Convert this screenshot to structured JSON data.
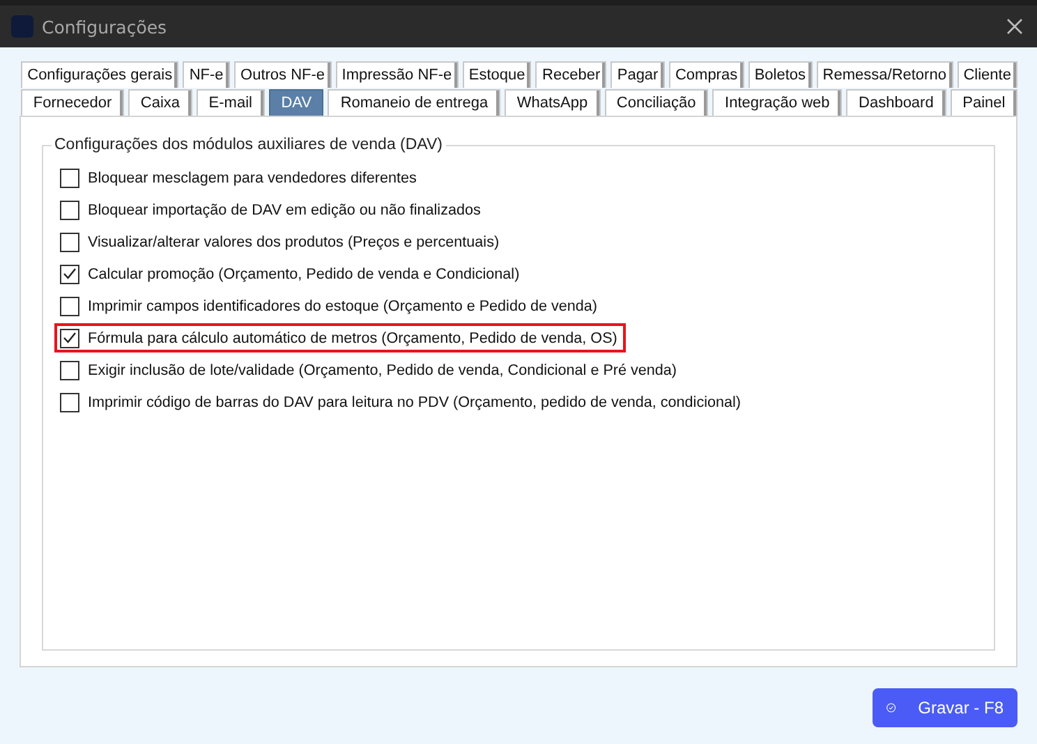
{
  "window": {
    "title": "Configurações"
  },
  "tab_rows": [
    [
      {
        "label": "Configurações gerais",
        "selected": false
      },
      {
        "label": "NF-e",
        "selected": false
      },
      {
        "label": "Outros NF-e",
        "selected": false
      },
      {
        "label": "Impressão NF-e",
        "selected": false
      },
      {
        "label": "Estoque",
        "selected": false
      },
      {
        "label": "Receber",
        "selected": false
      },
      {
        "label": "Pagar",
        "selected": false
      },
      {
        "label": "Compras",
        "selected": false
      },
      {
        "label": "Boletos",
        "selected": false
      },
      {
        "label": "Remessa/Retorno",
        "selected": false
      },
      {
        "label": "Cliente",
        "selected": false
      }
    ],
    [
      {
        "label": "Fornecedor",
        "selected": false
      },
      {
        "label": "Caixa",
        "selected": false
      },
      {
        "label": "E-mail",
        "selected": false
      },
      {
        "label": "DAV",
        "selected": true
      },
      {
        "label": "Romaneio de entrega",
        "selected": false
      },
      {
        "label": "WhatsApp",
        "selected": false
      },
      {
        "label": "Conciliação",
        "selected": false
      },
      {
        "label": "Integração web",
        "selected": false
      },
      {
        "label": "Dashboard",
        "selected": false
      },
      {
        "label": "Painel",
        "selected": false
      }
    ]
  ],
  "group": {
    "title": "Configurações dos módulos auxiliares de venda (DAV)",
    "options": [
      {
        "label": "Bloquear mesclagem para vendedores diferentes",
        "checked": false,
        "highlighted": false
      },
      {
        "label": "Bloquear importação de DAV em edição ou não finalizados",
        "checked": false,
        "highlighted": false
      },
      {
        "label": "Visualizar/alterar valores dos produtos (Preços e percentuais)",
        "checked": false,
        "highlighted": false
      },
      {
        "label": "Calcular promoção (Orçamento, Pedido de venda e Condicional)",
        "checked": true,
        "highlighted": false
      },
      {
        "label": "Imprimir campos identificadores do estoque (Orçamento e Pedido de venda)",
        "checked": false,
        "highlighted": false
      },
      {
        "label": "Fórmula para cálculo automático de metros (Orçamento, Pedido de venda, OS)",
        "checked": true,
        "highlighted": true
      },
      {
        "label": "Exigir inclusão de lote/validade (Orçamento, Pedido de venda, Condicional e Pré venda)",
        "checked": false,
        "highlighted": false
      },
      {
        "label": "Imprimir código de barras do DAV para leitura no PDV (Orçamento, pedido de venda, condicional)",
        "checked": false,
        "highlighted": false
      }
    ]
  },
  "save_button": {
    "label": "Gravar - F8"
  }
}
